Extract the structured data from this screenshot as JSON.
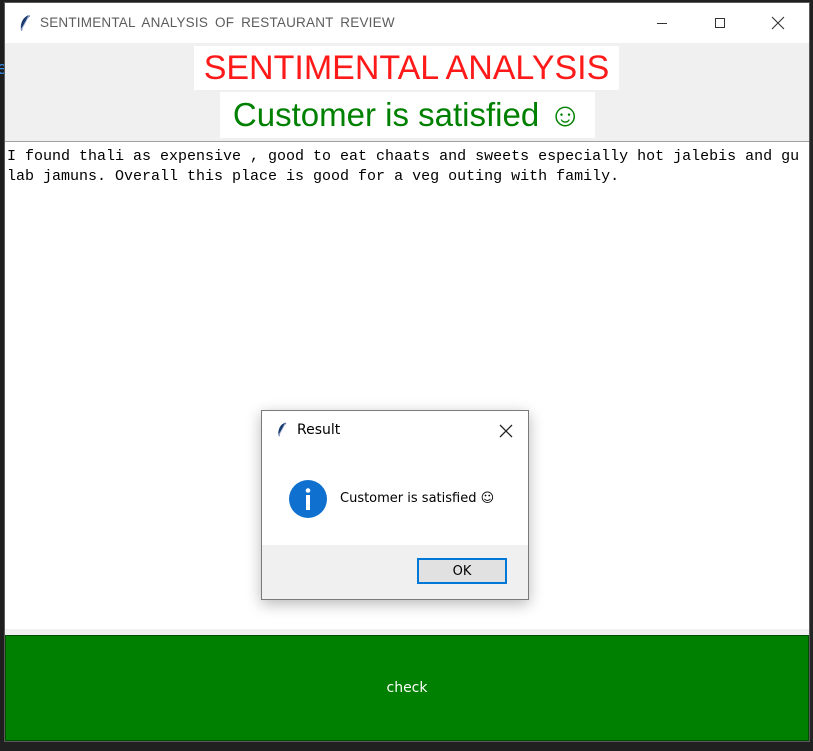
{
  "window": {
    "title": "SENTIMENTAL  ANALYSIS  OF  RESTAURANT  REVIEW"
  },
  "header": {
    "heading": "SENTIMENTAL  ANALYSIS",
    "result": "Customer is satisfied ☺"
  },
  "review": {
    "text": "I found thali as expensive , good to eat chaats and sweets especially hot jalebis and gulab jamuns. Overall this place is good for a veg outing with family."
  },
  "check_button": {
    "label": "check"
  },
  "dialog": {
    "title": "Result",
    "icon": "info-icon",
    "message": "Customer is satisfied ☺",
    "ok_label": "OK"
  },
  "colors": {
    "heading": "#ff1a1a",
    "result": "#008000",
    "check_bg": "#008000",
    "dialog_accent": "#0078d7"
  }
}
